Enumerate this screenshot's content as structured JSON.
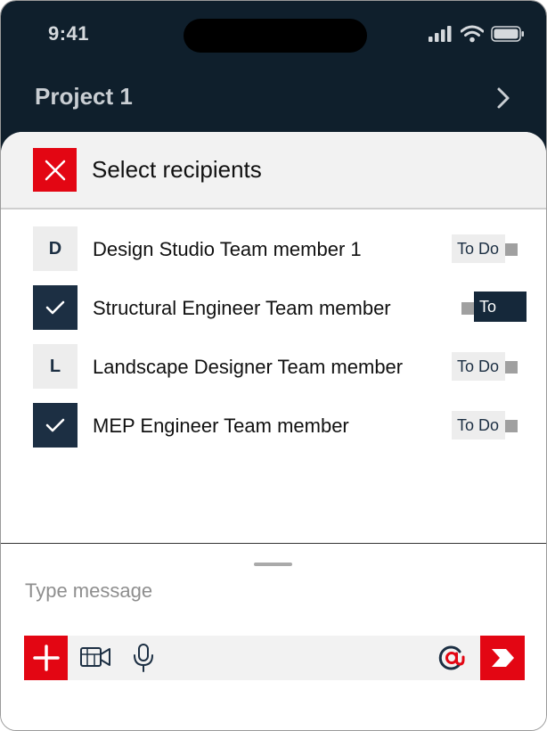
{
  "status_bar": {
    "time": "9:41"
  },
  "nav": {
    "title": "Project 1"
  },
  "sheet": {
    "title": "Select recipients",
    "recipients": [
      {
        "name": "Design Studio Team member 1",
        "avatar_letter": "D",
        "selected": false,
        "status": "To Do",
        "toggle_on": false
      },
      {
        "name": "Structural Engineer Team member",
        "avatar_letter": "",
        "selected": true,
        "status": "To Do",
        "toggle_on": true
      },
      {
        "name": "Landscape Designer Team member",
        "avatar_letter": "L",
        "selected": false,
        "status": "To Do",
        "toggle_on": false
      },
      {
        "name": "MEP Engineer Team member",
        "avatar_letter": "",
        "selected": true,
        "status": "To Do",
        "toggle_on": false
      }
    ]
  },
  "composer": {
    "placeholder": "Type message"
  },
  "colors": {
    "brand_red": "#e30613",
    "navy": "#1c2f43",
    "header_dark": "#0f1f2c"
  },
  "icons": [
    "signal-icon",
    "wifi-icon",
    "battery-icon",
    "chevron-right-icon",
    "close-icon",
    "check-icon",
    "plus-icon",
    "video-icon",
    "microphone-icon",
    "at-sign-icon",
    "send-icon"
  ]
}
